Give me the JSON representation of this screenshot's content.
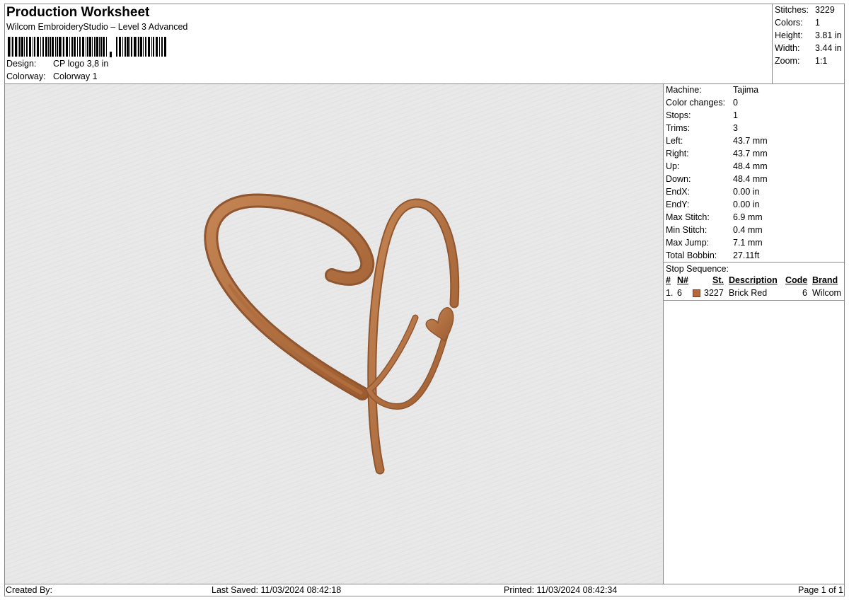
{
  "header": {
    "title": "Production Worksheet",
    "subtitle": "Wilcom EmbroideryStudio – Level 3 Advanced",
    "design_label": "Design:",
    "design_value": "CP logo 3,8 in",
    "colorway_label": "Colorway:",
    "colorway_value": "Colorway 1"
  },
  "summary": {
    "stitches_label": "Stitches:",
    "stitches_value": "3229",
    "colors_label": "Colors:",
    "colors_value": "1",
    "height_label": "Height:",
    "height_value": "3.81 in",
    "width_label": "Width:",
    "width_value": "3.44 in",
    "zoom_label": "Zoom:",
    "zoom_value": "1:1"
  },
  "machine_info": [
    {
      "label": "Machine:",
      "value": "Tajima"
    },
    {
      "label": "Color changes:",
      "value": "0"
    },
    {
      "label": "Stops:",
      "value": "1"
    },
    {
      "label": "Trims:",
      "value": "3"
    },
    {
      "label": "Left:",
      "value": "43.7 mm"
    },
    {
      "label": "Right:",
      "value": "43.7 mm"
    },
    {
      "label": "Up:",
      "value": "48.4 mm"
    },
    {
      "label": "Down:",
      "value": "48.4 mm"
    },
    {
      "label": "EndX:",
      "value": "0.00 in"
    },
    {
      "label": "EndY:",
      "value": "0.00 in"
    },
    {
      "label": "Max Stitch:",
      "value": "6.9 mm"
    },
    {
      "label": "Min Stitch:",
      "value": "0.4 mm"
    },
    {
      "label": "Max Jump:",
      "value": "7.1 mm"
    },
    {
      "label": "Total Bobbin:",
      "value": "27.11ft"
    }
  ],
  "stop_sequence": {
    "title": "Stop Sequence:",
    "headers": {
      "num": "#",
      "n": "N#",
      "st": "St.",
      "description": "Description",
      "code": "Code",
      "brand": "Brand"
    },
    "rows": [
      {
        "num": "1.",
        "n": "6",
        "color": "#b9683b",
        "st": "3227",
        "description": "Brick Red",
        "code": "6",
        "brand": "Wilcom"
      }
    ]
  },
  "design": {
    "thread_color": "#b06e3f",
    "fabric_color": "#e8e8e8"
  },
  "footer": {
    "created_by": "Created By:",
    "last_saved": "Last Saved: 11/03/2024 08:42:18",
    "printed": "Printed: 11/03/2024 08:42:34",
    "page": "Page 1 of 1"
  }
}
